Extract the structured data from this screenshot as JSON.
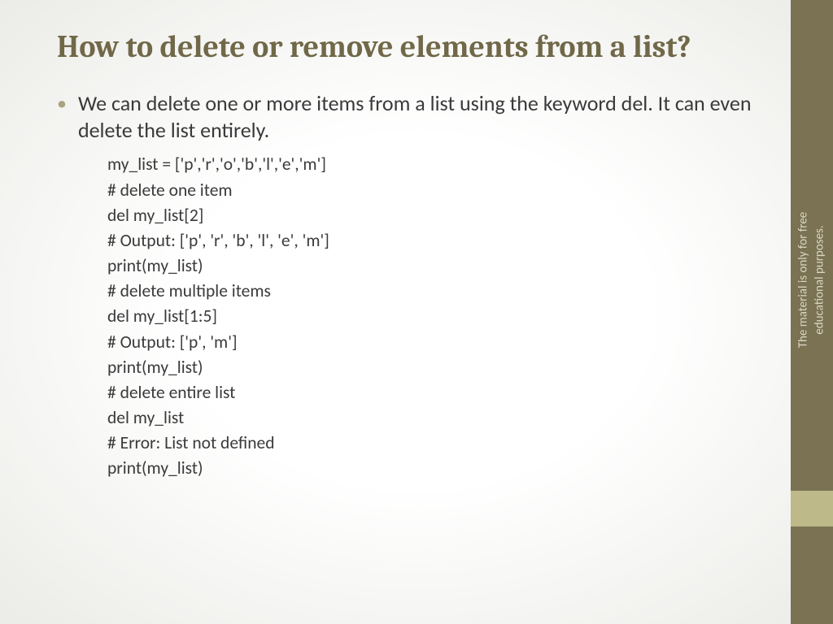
{
  "slide": {
    "title": "How to delete or remove elements from a list?",
    "bullet_text": "We can delete one or more items from a list using the keyword del. It can even delete the list entirely.",
    "code_lines": [
      "my_list = ['p','r','o','b','l','e','m']",
      "# delete one item",
      "del my_list[2]",
      "# Output: ['p', 'r', 'b', 'l', 'e', 'm']",
      "print(my_list)",
      "# delete multiple items",
      "del my_list[1:5]",
      "# Output: ['p', 'm']",
      "print(my_list)",
      "# delete entire list",
      "del my_list",
      "# Error: List not defined",
      "print(my_list)"
    ],
    "sidebar_text": "The material is only for free\neducational purposes."
  }
}
